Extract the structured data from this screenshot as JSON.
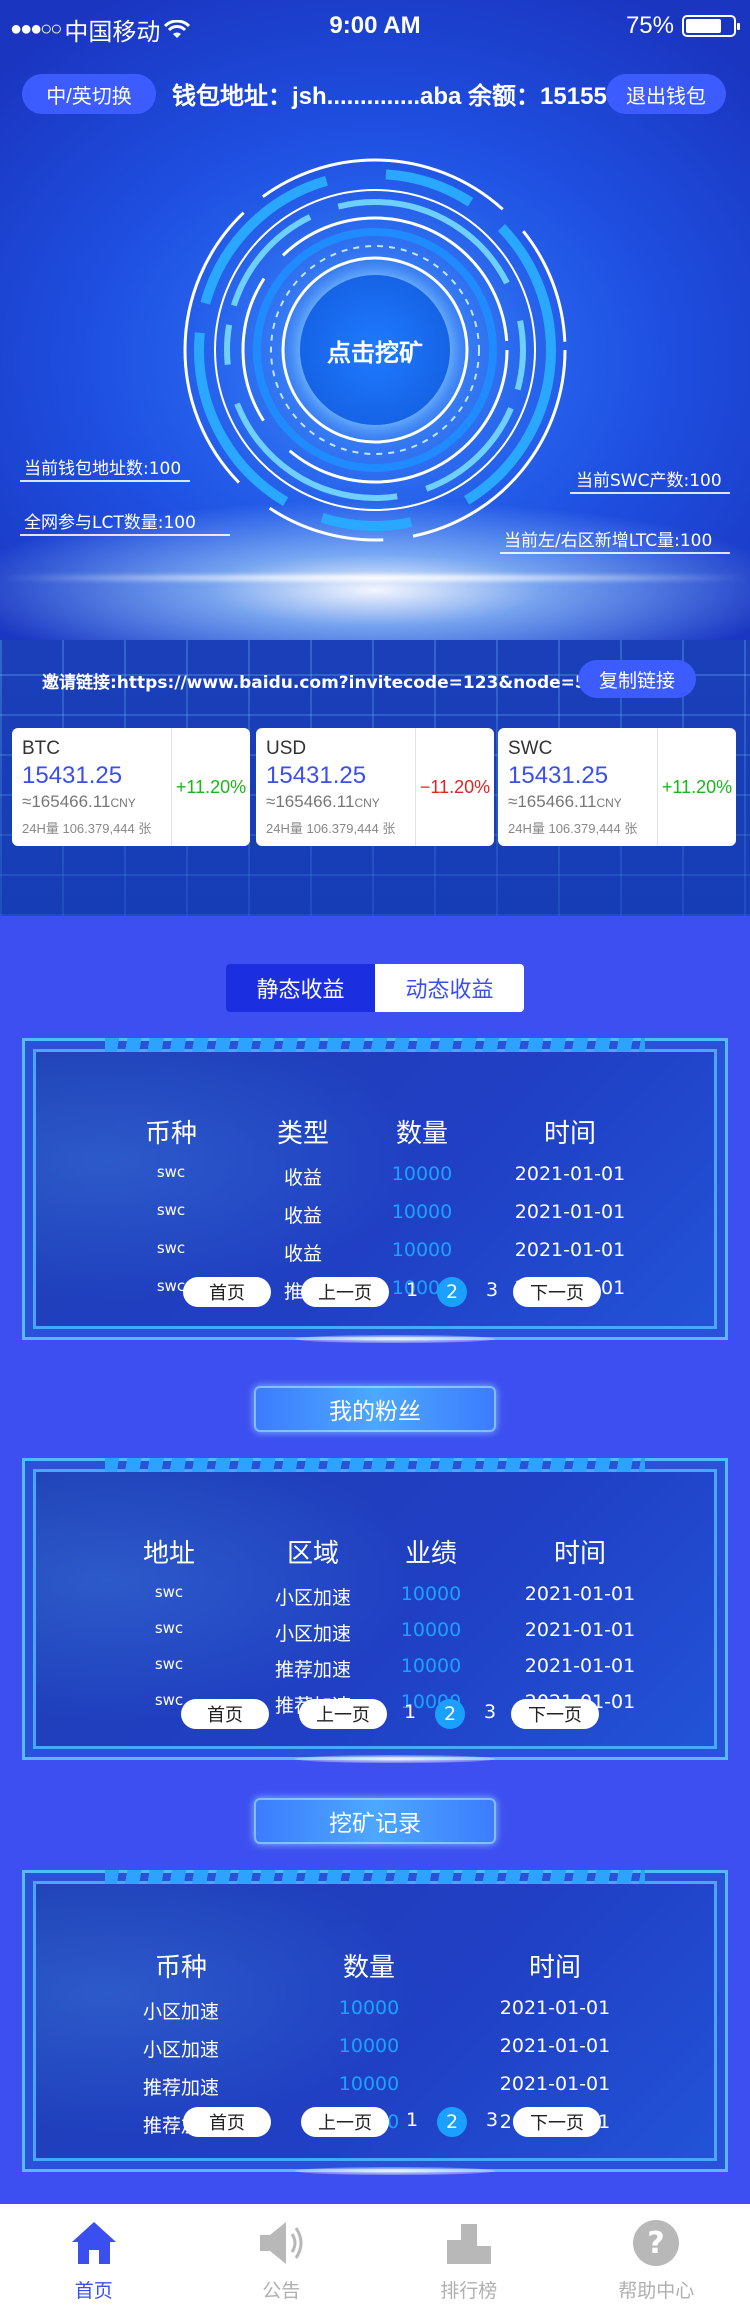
{
  "status_bar": {
    "carrier": "中国移动",
    "time": "9:00 AM",
    "battery": "75%"
  },
  "header": {
    "lang_button": "中/英切换",
    "wallet_info": "钱包地址：jsh..............aba 余额：15155",
    "exit_button": "退出钱包"
  },
  "mining": {
    "button": "点击挖矿"
  },
  "stats": {
    "wallet_count": "当前钱包地址数:100",
    "lct_count": "全网参与LCT数量:100",
    "swc_output": "当前SWC产数:100",
    "ltc_added": "当前左/右区新增LTC量:100"
  },
  "invite": {
    "link": "邀请链接:https://www.baidu.com?invitecode=123&node=5757",
    "copy_button": "复制链接"
  },
  "prices": [
    {
      "symbol": "BTC",
      "price": "15431.25",
      "cny": "≈165466.11",
      "cny_unit": "CNY",
      "volume": "24H量 106.379,444 张",
      "change": "+11.20%"
    },
    {
      "symbol": "USD",
      "price": "15431.25",
      "cny": "≈165466.11",
      "cny_unit": "CNY",
      "volume": "24H量 106.379,444 张",
      "change": "−11.20%"
    },
    {
      "symbol": "SWC",
      "price": "15431.25",
      "cny": "≈165466.11",
      "cny_unit": "CNY",
      "volume": "24H量 106.379,444 张",
      "change": "+11.20%"
    }
  ],
  "colors": {
    "up": "#18b818",
    "down": "#e32323",
    "accent": "#3b4ff0"
  },
  "tabs": {
    "static": "静态收益",
    "dynamic": "动态收益",
    "active": "static"
  },
  "earnings": {
    "headers": [
      "币种",
      "类型",
      "数量",
      "时间"
    ],
    "rows": [
      [
        "swc",
        "收益",
        "10000",
        "2021-01-01"
      ],
      [
        "swc",
        "收益",
        "10000",
        "2021-01-01"
      ],
      [
        "swc",
        "收益",
        "10000",
        "2021-01-01"
      ],
      [
        "swc",
        "推荐",
        "10000",
        "2021-01-01"
      ]
    ]
  },
  "pager": {
    "first": "首页",
    "prev": "上一页",
    "pages": [
      "1",
      "2",
      "3"
    ],
    "current": "2",
    "next": "下一页"
  },
  "fans": {
    "title": "我的粉丝",
    "headers": [
      "地址",
      "区域",
      "业绩",
      "时间"
    ],
    "rows": [
      [
        "swc",
        "小区加速",
        "10000",
        "2021-01-01"
      ],
      [
        "swc",
        "小区加速",
        "10000",
        "2021-01-01"
      ],
      [
        "swc",
        "推荐加速",
        "10000",
        "2021-01-01"
      ],
      [
        "swc",
        "推荐加速",
        "10000",
        "2021-01-01"
      ]
    ]
  },
  "mining_records": {
    "title": "挖矿记录",
    "headers": [
      "币种",
      "数量",
      "时间"
    ],
    "rows": [
      [
        "小区加速",
        "10000",
        "2021-01-01"
      ],
      [
        "小区加速",
        "10000",
        "2021-01-01"
      ],
      [
        "推荐加速",
        "10000",
        "2021-01-01"
      ],
      [
        "推荐加速",
        "10000",
        "2021-01-01"
      ]
    ]
  },
  "nav": [
    {
      "label": "首页",
      "icon": "home-icon",
      "active": true
    },
    {
      "label": "公告",
      "icon": "speaker-icon",
      "active": false
    },
    {
      "label": "排行榜",
      "icon": "podium-icon",
      "active": false
    },
    {
      "label": "帮助中心",
      "icon": "help-icon",
      "active": false
    }
  ]
}
